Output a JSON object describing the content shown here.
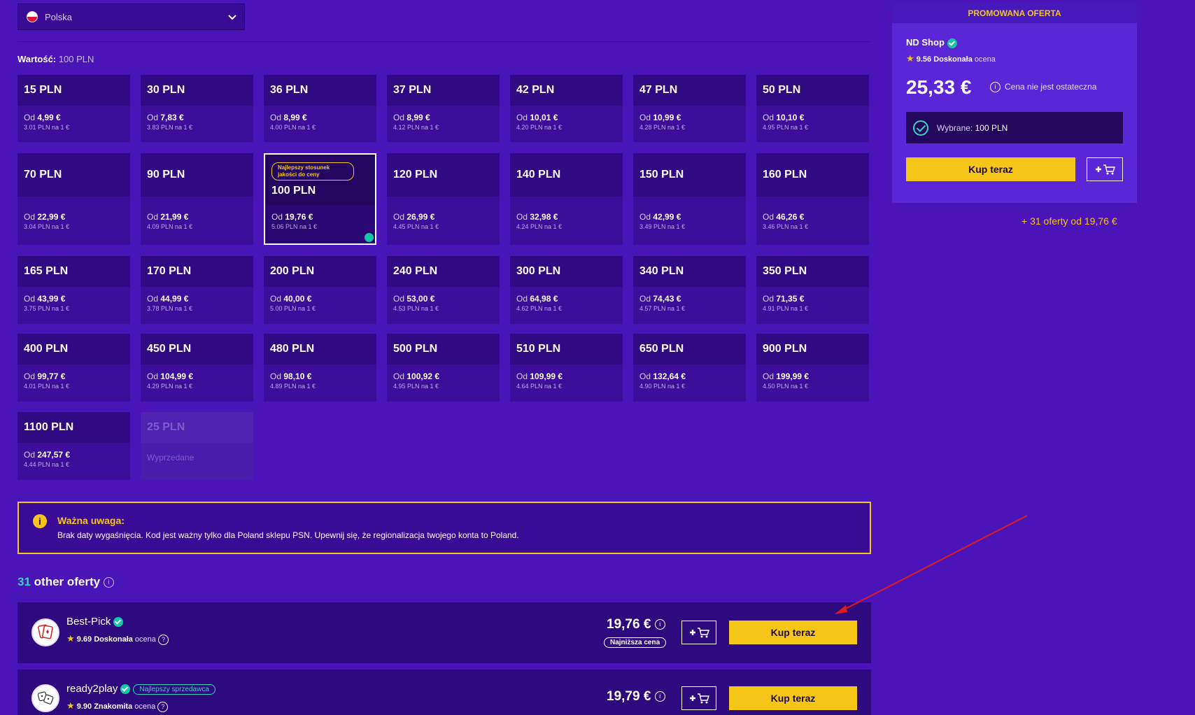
{
  "country": {
    "label": "Polska"
  },
  "value": {
    "label": "Wartość:",
    "amount": "100 PLN"
  },
  "denominations": [
    {
      "name": "15 PLN",
      "od": "Od",
      "price": "4,99 €",
      "rate": "3.01 PLN na 1 €"
    },
    {
      "name": "30 PLN",
      "od": "Od",
      "price": "7,83 €",
      "rate": "3.83 PLN na 1 €"
    },
    {
      "name": "36 PLN",
      "od": "Od",
      "price": "8,99 €",
      "rate": "4.00 PLN na 1 €"
    },
    {
      "name": "37 PLN",
      "od": "Od",
      "price": "8,99 €",
      "rate": "4.12 PLN na 1 €"
    },
    {
      "name": "42 PLN",
      "od": "Od",
      "price": "10,01 €",
      "rate": "4.20 PLN na 1 €"
    },
    {
      "name": "47 PLN",
      "od": "Od",
      "price": "10,99 €",
      "rate": "4.28 PLN na 1 €"
    },
    {
      "name": "50 PLN",
      "od": "Od",
      "price": "10,10 €",
      "rate": "4.95 PLN na 1 €"
    },
    {
      "name": "70 PLN",
      "od": "Od",
      "price": "22,99 €",
      "rate": "3.04 PLN na 1 €"
    },
    {
      "name": "90 PLN",
      "od": "Od",
      "price": "21,99 €",
      "rate": "4.09 PLN na 1 €"
    },
    {
      "name": "100 PLN",
      "od": "Od",
      "price": "19,76 €",
      "rate": "5.06 PLN na 1 €",
      "badge": "Najlepszy stosunek jakości do ceny"
    },
    {
      "name": "120 PLN",
      "od": "Od",
      "price": "26,99 €",
      "rate": "4.45 PLN na 1 €"
    },
    {
      "name": "140 PLN",
      "od": "Od",
      "price": "32,98 €",
      "rate": "4.24 PLN na 1 €"
    },
    {
      "name": "150 PLN",
      "od": "Od",
      "price": "42,99 €",
      "rate": "3.49 PLN na 1 €"
    },
    {
      "name": "160 PLN",
      "od": "Od",
      "price": "46,26 €",
      "rate": "3.46 PLN na 1 €"
    },
    {
      "name": "165 PLN",
      "od": "Od",
      "price": "43,99 €",
      "rate": "3.75 PLN na 1 €"
    },
    {
      "name": "170 PLN",
      "od": "Od",
      "price": "44,99 €",
      "rate": "3.78 PLN na 1 €"
    },
    {
      "name": "200 PLN",
      "od": "Od",
      "price": "40,00 €",
      "rate": "5.00 PLN na 1 €"
    },
    {
      "name": "240 PLN",
      "od": "Od",
      "price": "53,00 €",
      "rate": "4.53 PLN na 1 €"
    },
    {
      "name": "300 PLN",
      "od": "Od",
      "price": "64,98 €",
      "rate": "4.62 PLN na 1 €"
    },
    {
      "name": "340 PLN",
      "od": "Od",
      "price": "74,43 €",
      "rate": "4.57 PLN na 1 €"
    },
    {
      "name": "350 PLN",
      "od": "Od",
      "price": "71,35 €",
      "rate": "4.91 PLN na 1 €"
    },
    {
      "name": "400 PLN",
      "od": "Od",
      "price": "99,77 €",
      "rate": "4.01 PLN na 1 €"
    },
    {
      "name": "450 PLN",
      "od": "Od",
      "price": "104,99 €",
      "rate": "4.29 PLN na 1 €"
    },
    {
      "name": "480 PLN",
      "od": "Od",
      "price": "98,10 €",
      "rate": "4.89 PLN na 1 €"
    },
    {
      "name": "500 PLN",
      "od": "Od",
      "price": "100,92 €",
      "rate": "4.95 PLN na 1 €"
    },
    {
      "name": "510 PLN",
      "od": "Od",
      "price": "109,99 €",
      "rate": "4.64 PLN na 1 €"
    },
    {
      "name": "650 PLN",
      "od": "Od",
      "price": "132,64 €",
      "rate": "4.90 PLN na 1 €"
    },
    {
      "name": "900 PLN",
      "od": "Od",
      "price": "199,99 €",
      "rate": "4.50 PLN na 1 €"
    },
    {
      "name": "1100 PLN",
      "od": "Od",
      "price": "247,57 €",
      "rate": "4.44 PLN na 1 €"
    },
    {
      "name": "25 PLN",
      "status": "Wyprzedane"
    }
  ],
  "notice": {
    "title": "Ważna uwaga:",
    "text": "Brak daty wygaśnięcia. Kod jest ważny tylko dla Poland sklepu PSN. Upewnij się, że regionalizacja twojego konta to Poland."
  },
  "offers_heading": {
    "count": "31",
    "label": "other oferty"
  },
  "offers": [
    {
      "seller": "Best-Pick",
      "score": "9.69",
      "quality": "Doskonała",
      "ocena": "ocena",
      "price": "19,76 €",
      "badge": "Najniższa cena",
      "buy": "Kup teraz"
    },
    {
      "seller": "ready2play",
      "seller_badge": "Najlepszy sprzedawca",
      "score": "9.90",
      "quality": "Znakomita",
      "ocena": "ocena",
      "price": "19,79 €",
      "buy": "Kup teraz"
    }
  ],
  "promo": {
    "header": "PROMOWANA OFERTA",
    "shop": "ND Shop",
    "score": "9.56",
    "quality": "Doskonała",
    "ocena": "ocena",
    "price": "25,33 €",
    "note": "Cena nie jest ostateczna",
    "selected_label": "Wybrane:",
    "selected_value": "100 PLN",
    "buy": "Kup teraz"
  },
  "more_offers": "+ 31 oferty od 19,76 €",
  "colors": {
    "bg": "#4a14b8",
    "accent": "#f5c518",
    "teal": "#38d3c1"
  }
}
